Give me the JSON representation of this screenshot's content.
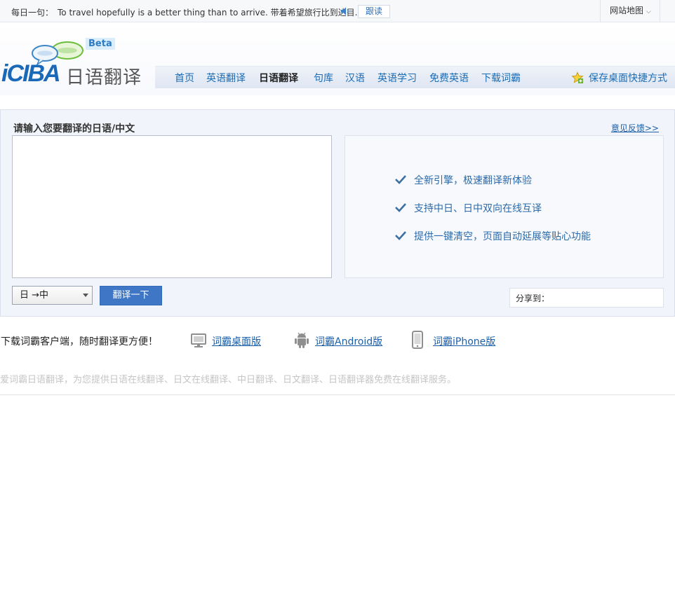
{
  "topbar": {
    "daily_label": "每日一句：",
    "daily_sentence": "To travel hopefully is a better thing than to arrive. 带着希望旅行比到达目...",
    "follow_label": "跟读",
    "sitemap_label": "网站地图"
  },
  "header": {
    "brand": "iCIBA",
    "product": "日语翻译",
    "beta": "Beta"
  },
  "nav": {
    "items": [
      {
        "label": "首页"
      },
      {
        "label": "英语翻译"
      },
      {
        "label": "日语翻译",
        "active": true
      },
      {
        "label": "句库"
      },
      {
        "label": "汉语"
      },
      {
        "label": "英语学习"
      },
      {
        "label": "免费英语"
      },
      {
        "label": "下载词霸"
      }
    ],
    "shortcut_label": "保存桌面快捷方式"
  },
  "translator": {
    "title": "请输入您要翻译的日语/中文",
    "feedback": "意见反馈>>",
    "input_value": "",
    "features": [
      "全新引擎，极速翻译新体验",
      "支持中日、日中双向在线互译",
      "提供一键清空，页面自动延展等贴心功能"
    ],
    "direction": "日 →中",
    "translate_button": "翻译一下",
    "share_label": "分享到："
  },
  "download": {
    "intro": "下载词霸客户端，随时翻译更方便！",
    "desktop": "词霸桌面版",
    "android": "词霸Android版",
    "iphone": "词霸iPhone版"
  },
  "seo_text": "爱词霸日语翻译，为您提供日语在线翻译、日文在线翻译、中日翻译、日文翻译、日语翻译器免费在线翻译服务。",
  "colors": {
    "link": "#1a6cb5",
    "button": "#3f77c6",
    "panel_bg": "#f1f4fb",
    "check": "#3a6fa4"
  }
}
